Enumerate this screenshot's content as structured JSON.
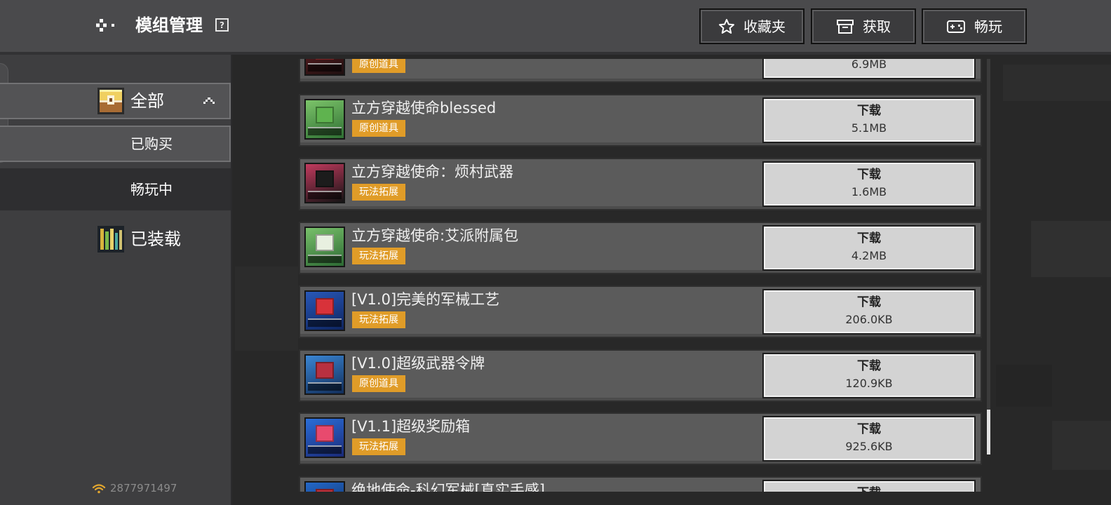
{
  "header": {
    "title": "模组管理",
    "help_label": "?",
    "back_icon": "back-arrow-icon",
    "buttons": [
      {
        "label": "收藏夹",
        "icon": "star-icon"
      },
      {
        "label": "获取",
        "icon": "box-icon"
      },
      {
        "label": "畅玩",
        "icon": "gamepad-icon"
      }
    ]
  },
  "sidebar": {
    "items": [
      {
        "label": "全部",
        "icon": "chest-icon",
        "expanded": true
      },
      {
        "label": "已购买",
        "selected": true
      },
      {
        "label": "畅玩中"
      },
      {
        "label": "已装载",
        "icon": "bookshelf-icon"
      }
    ],
    "status_icon": "wifi-icon",
    "account_id": "2877971497"
  },
  "mods": [
    {
      "title": "",
      "tag": "原创道具",
      "action": "",
      "size": "6.9MB",
      "thumb_colors": [
        "#6a1f24",
        "#1e1010",
        "#c83a3a"
      ]
    },
    {
      "title": "立方穿越使命blessed",
      "tag": "原创道具",
      "action": "下载",
      "size": "5.1MB",
      "thumb_colors": [
        "#7cc46a",
        "#2f6f33",
        "#5fb34f"
      ]
    },
    {
      "title": "立方穿越使命：烦村武器",
      "tag": "玩法拓展",
      "action": "下载",
      "size": "1.6MB",
      "thumb_colors": [
        "#c23a5e",
        "#141414",
        "#1c1c1c"
      ]
    },
    {
      "title": "立方穿越使命:艾派附属包",
      "tag": "玩法拓展",
      "action": "下载",
      "size": "4.2MB",
      "thumb_colors": [
        "#78c06a",
        "#2d6a34",
        "#e8f0e0"
      ]
    },
    {
      "title": "[V1.0]完美的军械工艺",
      "tag": "玩法拓展",
      "action": "下载",
      "size": "206.0KB",
      "thumb_colors": [
        "#2858b8",
        "#0e2560",
        "#d8323a"
      ]
    },
    {
      "title": "[V1.0]超级武器令牌",
      "tag": "原创道具",
      "action": "下载",
      "size": "120.9KB",
      "thumb_colors": [
        "#3a86d4",
        "#122e5a",
        "#b83040"
      ]
    },
    {
      "title": "[V1.1]超级奖励箱",
      "tag": "玩法拓展",
      "action": "下载",
      "size": "925.6KB",
      "thumb_colors": [
        "#2a6ed8",
        "#1a2a78",
        "#e84a6e"
      ]
    },
    {
      "title": "绝地使命-科幻军械[真实手感]",
      "tag": "",
      "action": "下载",
      "size": "",
      "thumb_colors": [
        "#2468c8",
        "#0e2a5c",
        "#c0303a"
      ]
    }
  ],
  "colors": {
    "tag_background": "#e09c28",
    "card_background": "#5b5b5b",
    "download_button": "#d3d3d3",
    "top_bar": "#4a4a4c",
    "sidebar": "#3e3e40",
    "status_icon": "#e2a62e"
  }
}
